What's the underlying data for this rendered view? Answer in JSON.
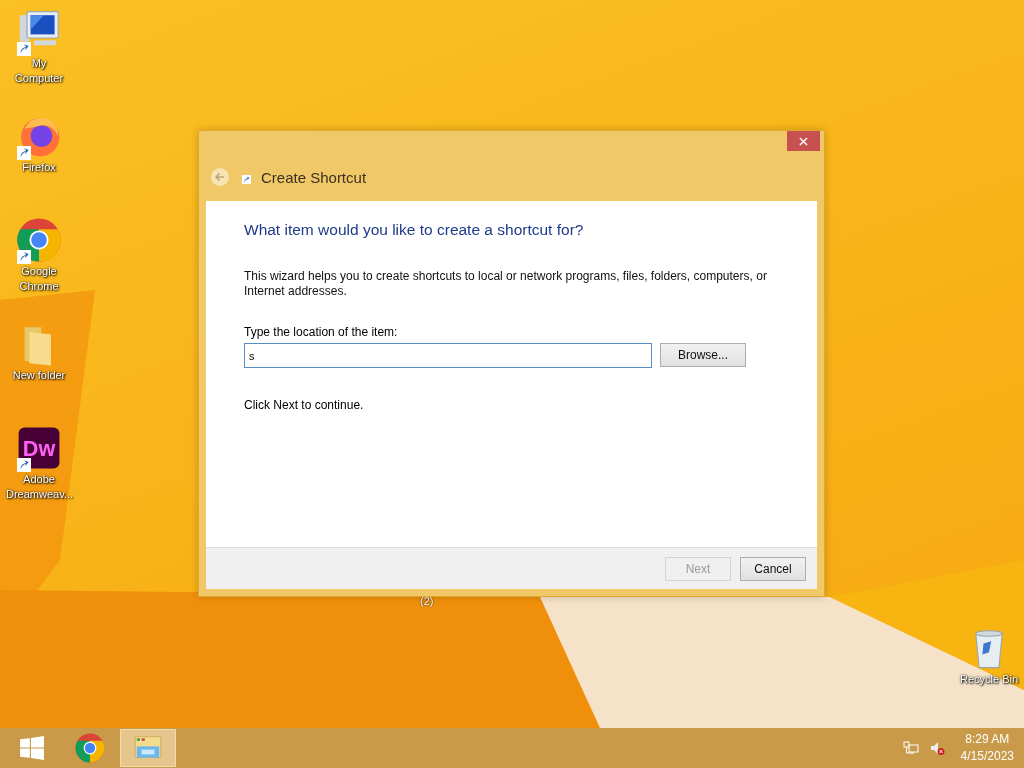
{
  "desktop": {
    "icons": [
      {
        "kind": "computer",
        "label": "My Computer",
        "shortcut": true
      },
      {
        "kind": "firefox",
        "label": "Firefox",
        "shortcut": true
      },
      {
        "kind": "chrome",
        "label": "Google Chrome",
        "shortcut": true
      },
      {
        "kind": "folder",
        "label": "New folder",
        "shortcut": false
      },
      {
        "kind": "dreamweaver",
        "label": "Adobe Dreamweav...",
        "shortcut": true,
        "logo_text": "Dw"
      }
    ],
    "recycle_bin": {
      "label": "Recycle Bin"
    },
    "stray_label": "(2)"
  },
  "dialog": {
    "title": "Create Shortcut",
    "back_disabled": true,
    "heading": "What item would you like to create a shortcut for?",
    "description": "This wizard helps you to create shortcuts to local or network programs, files, folders, computers, or Internet addresses.",
    "field_label": "Type the location of the item:",
    "field_value": "s",
    "browse_button": "Browse...",
    "note": "Click Next to continue.",
    "buttons": [
      {
        "label": "Next",
        "disabled": true
      },
      {
        "label": "Cancel",
        "disabled": false
      }
    ]
  },
  "taskbar": {
    "items": [
      {
        "kind": "start",
        "selected": false
      },
      {
        "kind": "chrome",
        "selected": false
      },
      {
        "kind": "explorer",
        "selected": true
      }
    ],
    "volume_muted": true,
    "time": "8:29 AM",
    "date": "4/15/2023"
  }
}
